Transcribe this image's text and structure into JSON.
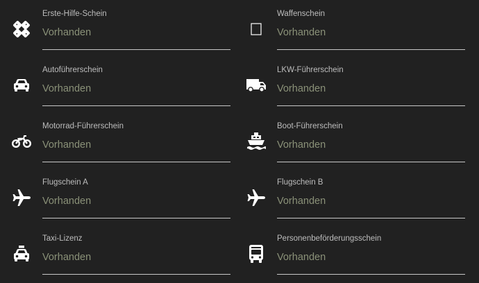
{
  "licenses": [
    {
      "label": "Erste-Hilfe-Schein",
      "value": "Vorhanden",
      "icon": "first-aid-icon"
    },
    {
      "label": "Waffenschein",
      "value": "Vorhanden",
      "icon": "placeholder-box-icon"
    },
    {
      "label": "Autoführerschein",
      "value": "Vorhanden",
      "icon": "car-icon"
    },
    {
      "label": "LKW-Führerschein",
      "value": "Vorhanden",
      "icon": "truck-icon"
    },
    {
      "label": "Motorrad-Führerschein",
      "value": "Vorhanden",
      "icon": "motorcycle-icon"
    },
    {
      "label": "Boot-Führerschein",
      "value": "Vorhanden",
      "icon": "ship-icon"
    },
    {
      "label": "Flugschein A",
      "value": "Vorhanden",
      "icon": "airplane-icon"
    },
    {
      "label": "Flugschein B",
      "value": "Vorhanden",
      "icon": "airplane-icon"
    },
    {
      "label": "Taxi-Lizenz",
      "value": "Vorhanden",
      "icon": "taxi-icon"
    },
    {
      "label": "Personenbeförderungsschein",
      "value": "Vorhanden",
      "icon": "bus-icon"
    }
  ],
  "colors": {
    "background": "#212121",
    "label": "#bdbdbd",
    "value": "#8a9178",
    "underline": "#c8c8c8",
    "icon": "#ffffff"
  }
}
